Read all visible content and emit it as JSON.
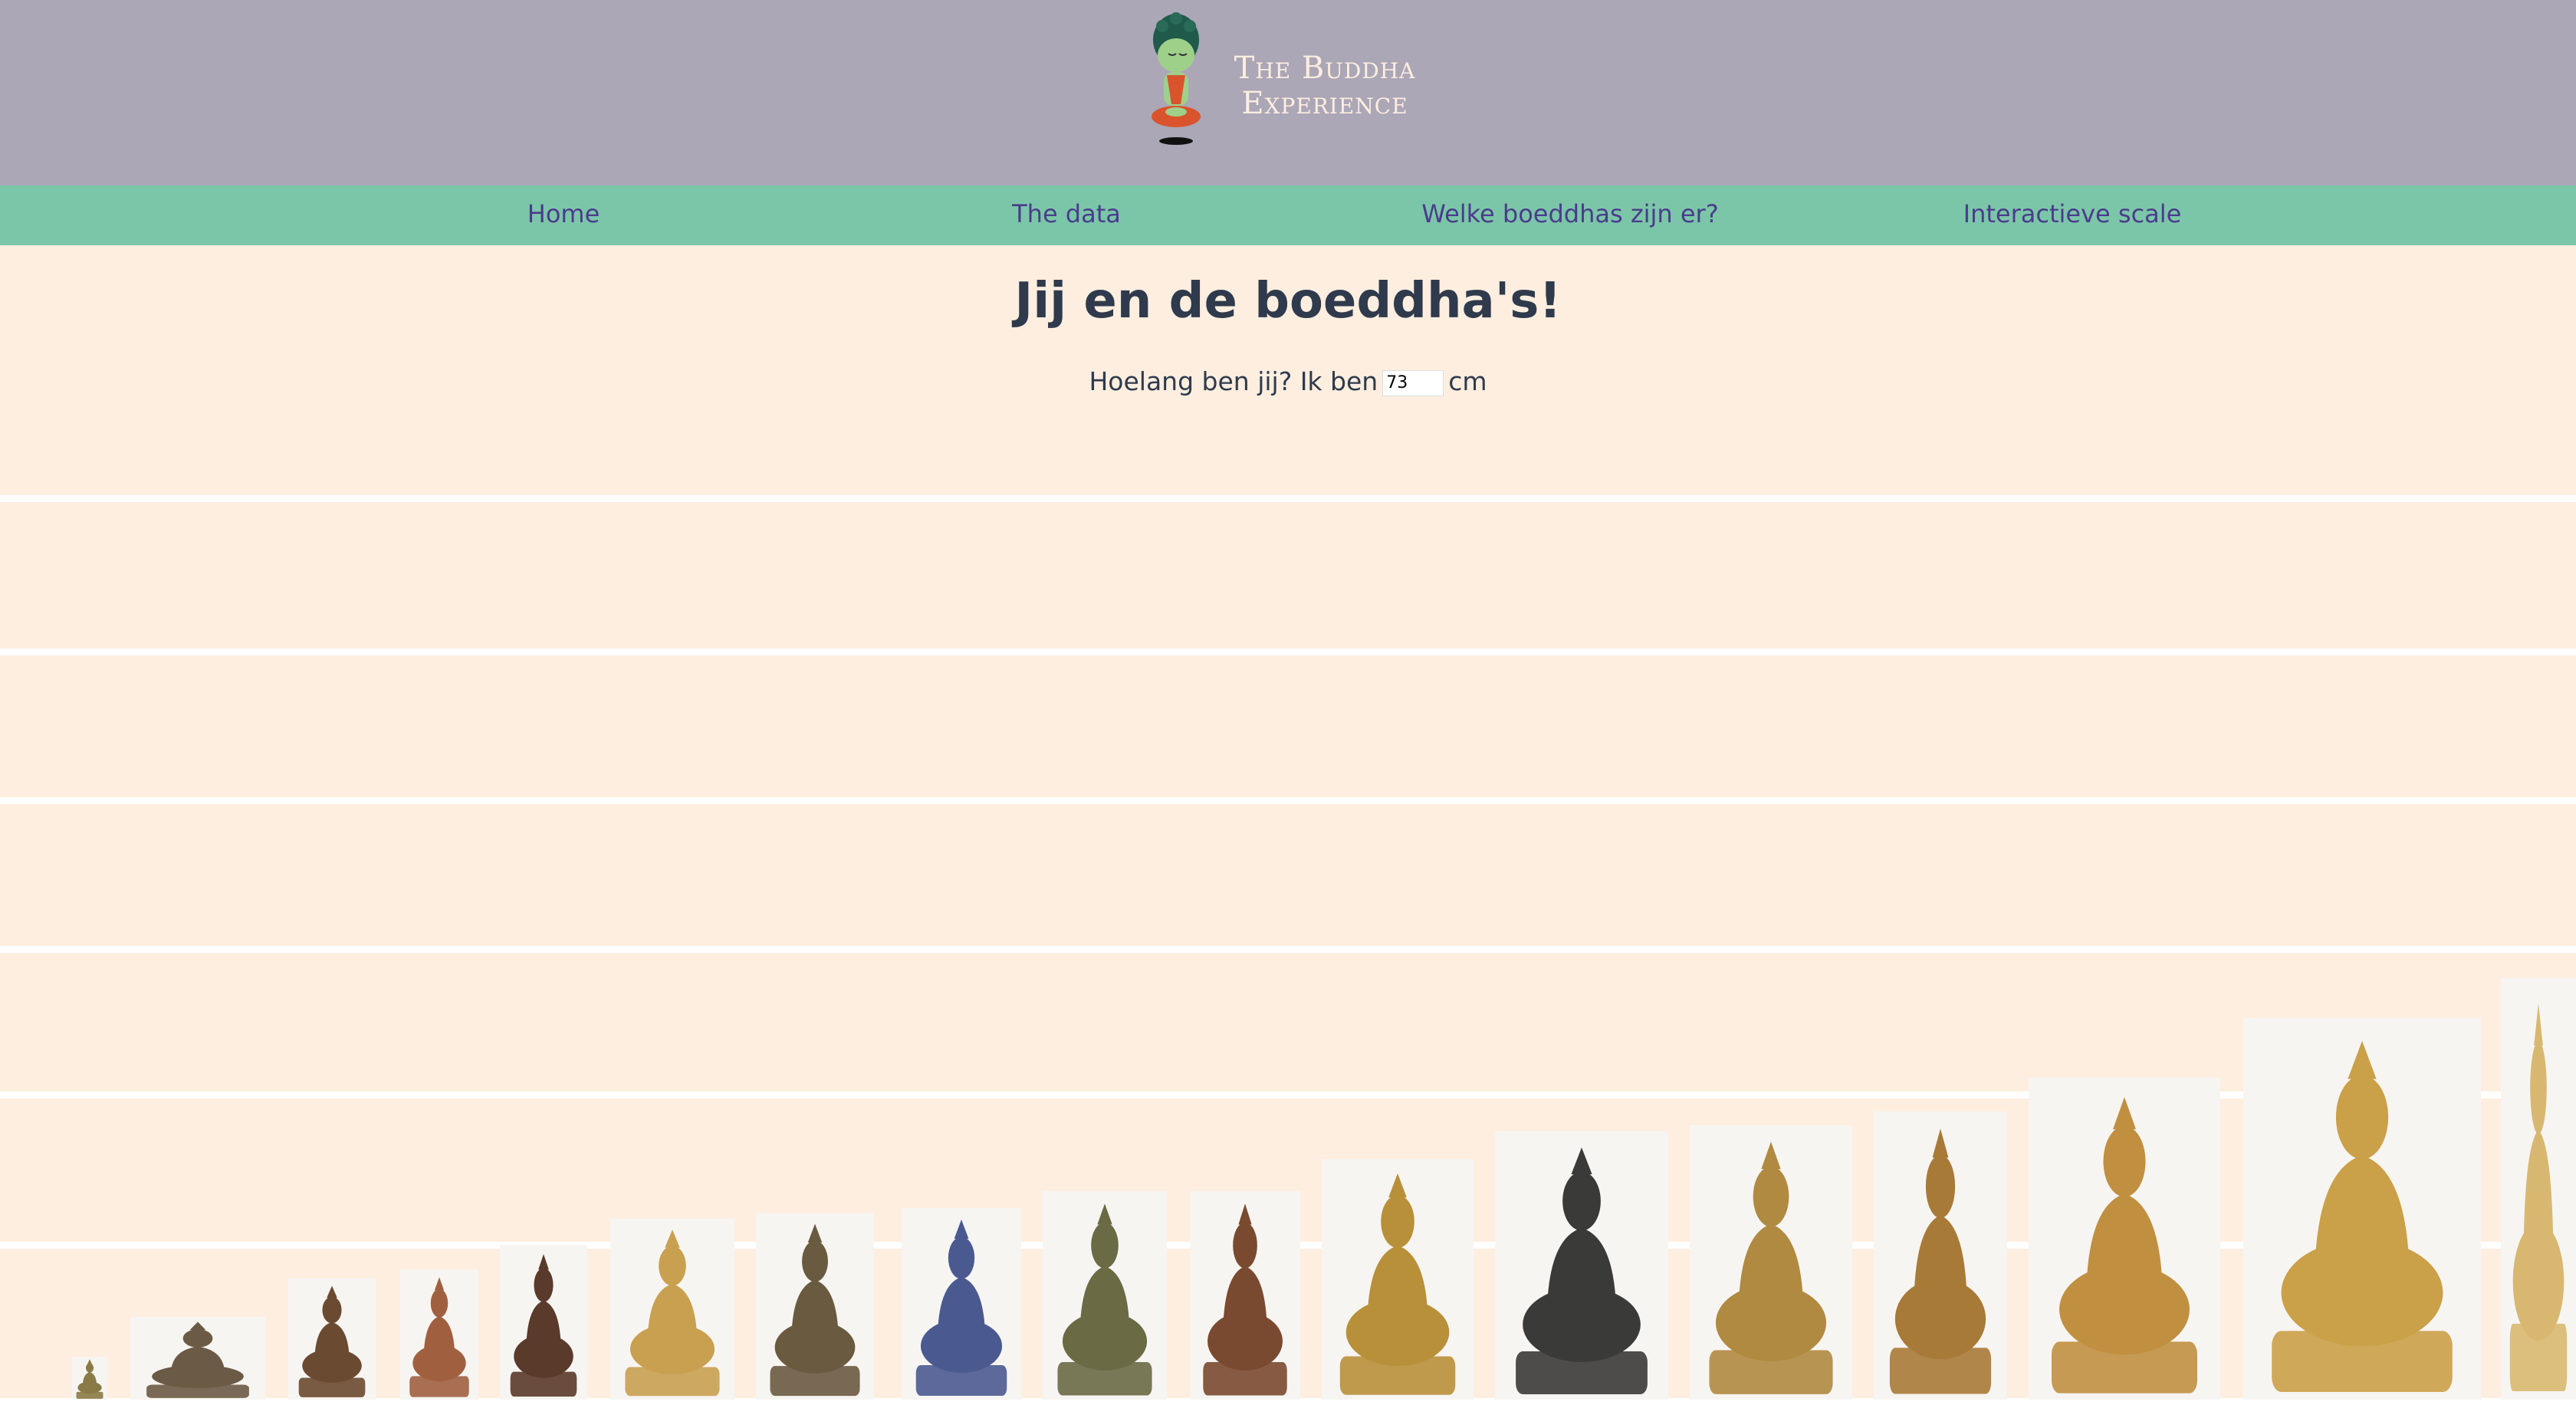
{
  "header": {
    "logo_line1": "The Buddha",
    "logo_line2": "Experience",
    "logo_icon": "buddha-mascot-icon"
  },
  "nav": {
    "items": [
      {
        "label": "Home"
      },
      {
        "label": "The data"
      },
      {
        "label": "Welke boeddhas zijn er?"
      },
      {
        "label": "Interactieve scale"
      }
    ]
  },
  "main": {
    "title": "Jij en de boeddha's!",
    "height_prompt": "Hoelang ben jij? Ik ben",
    "height_value": "73",
    "height_unit": "cm"
  },
  "colors": {
    "header_bg": "#aba7b6",
    "nav_bg": "#7bc6a8",
    "nav_text": "#4a3c8c",
    "page_bg": "#fdeee0",
    "title_text": "#2f3a4c",
    "gold": "#b8913a",
    "bronze": "#5a4a3a"
  },
  "statues": [
    {
      "name": "seated-buddha-statue-tiny",
      "tone": "#8a7a45"
    },
    {
      "name": "reclining-buddha-statue",
      "tone": "#6b5a45"
    },
    {
      "name": "shrine-buddha-statue",
      "tone": "#6a4a30"
    },
    {
      "name": "haloed-buddha-statue",
      "tone": "#a06040"
    },
    {
      "name": "crowned-bronze-statue",
      "tone": "#5a3a2a"
    },
    {
      "name": "golden-bodhisattva-statue",
      "tone": "#c8a050"
    },
    {
      "name": "bronze-seated-buddha-statue",
      "tone": "#6a5a40"
    },
    {
      "name": "blue-niche-buddha-statue",
      "tone": "#4a5a90"
    },
    {
      "name": "green-bronze-buddha-statue",
      "tone": "#6a6a45"
    },
    {
      "name": "copper-standing-figure-statue",
      "tone": "#7a4a30"
    },
    {
      "name": "golden-crowned-buddha-statue",
      "tone": "#b8903a"
    },
    {
      "name": "dark-bronze-tara-statue",
      "tone": "#3a3a38"
    },
    {
      "name": "gilded-throne-buddha-statue",
      "tone": "#b08a40"
    },
    {
      "name": "standing-golden-buddha-statue",
      "tone": "#a87a38"
    },
    {
      "name": "golden-amitayus-statue",
      "tone": "#c09040"
    },
    {
      "name": "large-golden-buddha-statue",
      "tone": "#caa048"
    },
    {
      "name": "partial-golden-statue",
      "tone": "#d8b870"
    }
  ]
}
